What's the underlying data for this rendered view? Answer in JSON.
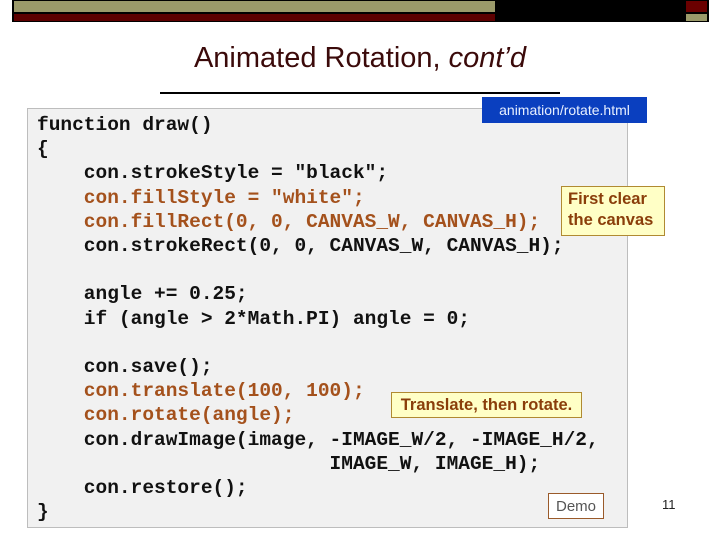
{
  "slide": {
    "title": "Animated Rotation, ",
    "title_italic": "cont’d",
    "file_tag": "animation/rotate.html",
    "page_number": "11",
    "demo_label": "Demo"
  },
  "code": {
    "lines": [
      "function draw()",
      "{",
      "    con.strokeStyle = \"black\";",
      "    con.fillStyle = \"white\";",
      "    con.fillRect(0, 0, CANVAS_W, CANVAS_H);",
      "    con.strokeRect(0, 0, CANVAS_W, CANVAS_H);",
      "",
      "    angle += 0.25;",
      "    if (angle > 2*Math.PI) angle = 0;",
      "",
      "    con.save();",
      "    con.translate(100, 100);",
      "    con.rotate(angle);",
      "    con.drawImage(image, -IMAGE_W/2, -IMAGE_H/2,",
      "                         IMAGE_W, IMAGE_H);",
      "    con.restore();",
      "}"
    ],
    "highlighted_lines": [
      3,
      4,
      11,
      12
    ]
  },
  "annotations": {
    "clear_note_line1": "First clear",
    "clear_note_line2": "the canvas",
    "transform_note": "Translate, then rotate."
  },
  "colors": {
    "header_olive": "#9b9a6a",
    "header_maroon": "#5c0000",
    "title": "#3b0a0a",
    "highlight_code": "#a4511c",
    "file_tag_bg": "#0a3fbf",
    "note_bg": "#ffffc6"
  }
}
